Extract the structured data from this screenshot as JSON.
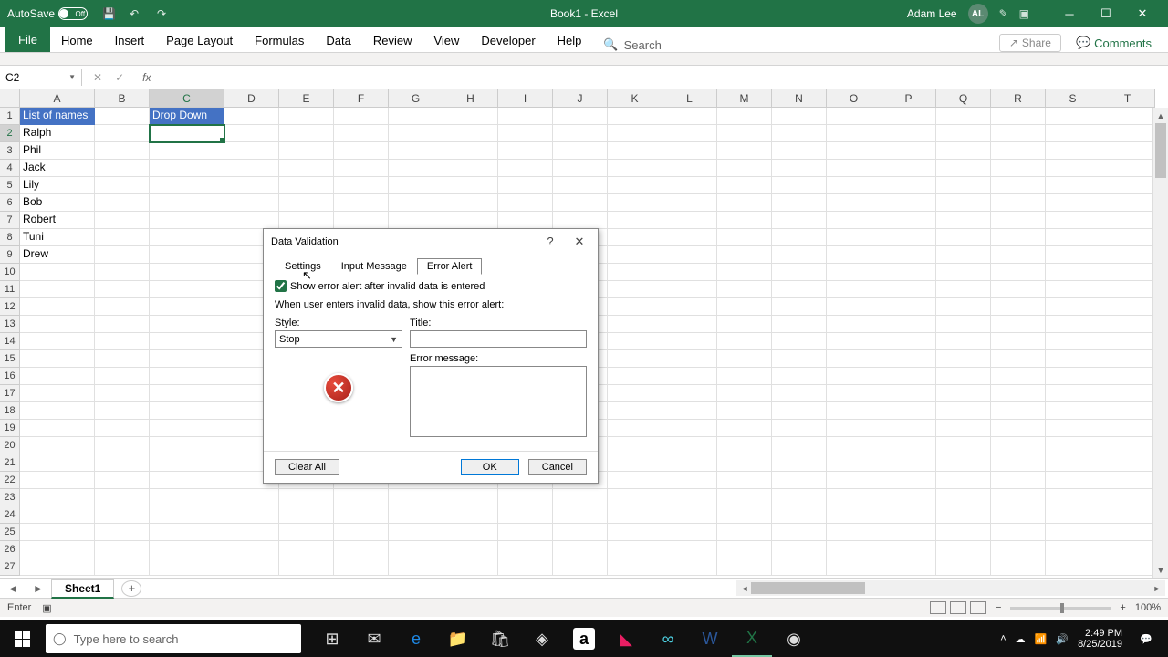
{
  "titlebar": {
    "autosave_label": "AutoSave",
    "autosave_state": "Off",
    "document_title": "Book1 - Excel",
    "user_name": "Adam Lee",
    "user_initials": "AL"
  },
  "ribbon": {
    "tabs": [
      "File",
      "Home",
      "Insert",
      "Page Layout",
      "Formulas",
      "Data",
      "Review",
      "View",
      "Developer",
      "Help"
    ],
    "search_placeholder": "Search",
    "share_label": "Share",
    "comments_label": "Comments"
  },
  "formula_bar": {
    "name_box": "C2",
    "fx_label": "fx"
  },
  "columns": [
    "A",
    "B",
    "C",
    "D",
    "E",
    "F",
    "G",
    "H",
    "I",
    "J",
    "K",
    "L",
    "M",
    "N",
    "O",
    "P",
    "Q",
    "R",
    "S",
    "T"
  ],
  "header_cells": {
    "A1": "List of names",
    "C1": "Drop Down"
  },
  "col_a_names": [
    "Ralph",
    "Phil",
    "Jack",
    "Lily",
    "Bob",
    "Robert",
    "Tuni",
    "Drew"
  ],
  "active_cell": "C2",
  "num_rows": 27,
  "sheet": {
    "active_tab": "Sheet1"
  },
  "status_bar": {
    "mode": "Enter",
    "zoom": "100%"
  },
  "dialog": {
    "title": "Data Validation",
    "tabs": {
      "settings": "Settings",
      "input_message": "Input Message",
      "error_alert": "Error Alert"
    },
    "active_tab": "error_alert",
    "checkbox_label": "Show error alert after invalid data is entered",
    "checkbox_checked": true,
    "instruction": "When user enters invalid data, show this error alert:",
    "style_label": "Style:",
    "style_value": "Stop",
    "title_field_label": "Title:",
    "title_field_value": "",
    "error_msg_label": "Error message:",
    "error_msg_value": "",
    "clear_all": "Clear All",
    "ok": "OK",
    "cancel": "Cancel"
  },
  "taskbar": {
    "search_placeholder": "Type here to search",
    "time": "2:49 PM",
    "date": "8/25/2019"
  }
}
